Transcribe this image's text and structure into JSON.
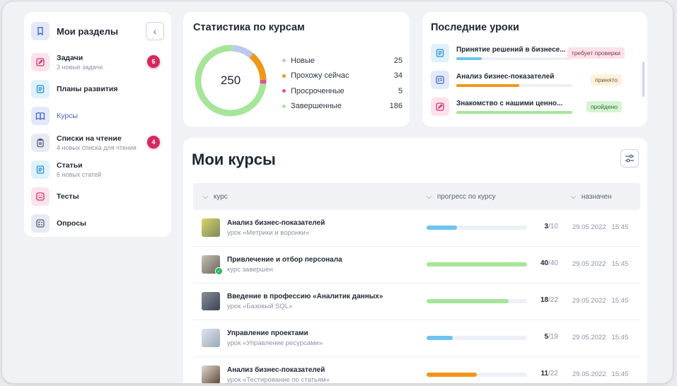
{
  "sidebar": {
    "title": "Мои разделы",
    "collapse_icon": "chevron-left-icon",
    "items": [
      {
        "label": "Задачи",
        "sub": "3 новые задачи",
        "badge": "6",
        "icon": "pencil-icon",
        "color": "pink"
      },
      {
        "label": "Планы развития",
        "sub": "",
        "badge": "",
        "icon": "document-icon",
        "color": "cyan"
      },
      {
        "label": "Курсы",
        "sub": "",
        "badge": "",
        "icon": "book-icon",
        "color": "blue",
        "active": true
      },
      {
        "label": "Списки на чтение",
        "sub": "4 новых списка для чтения",
        "badge": "4",
        "icon": "clipboard-icon",
        "color": "gray"
      },
      {
        "label": "Статьи",
        "sub": "6 новых статей",
        "badge": "",
        "icon": "document-icon",
        "color": "cyan"
      },
      {
        "label": "Тесты",
        "sub": "",
        "badge": "",
        "icon": "quiz-icon",
        "color": "pink"
      },
      {
        "label": "Опросы",
        "sub": "",
        "badge": "",
        "icon": "checklist-icon",
        "color": "gray"
      }
    ]
  },
  "stats": {
    "title": "Статистика по курсам",
    "total": "250",
    "items": [
      {
        "name": "Новые",
        "value": 25,
        "color": "#b7c9ef"
      },
      {
        "name": "Прохожу сейчас",
        "value": 34,
        "color": "#f0971b"
      },
      {
        "name": "Просроченные",
        "value": 5,
        "color": "#e0568f"
      },
      {
        "name": "Завершенные",
        "value": 186,
        "color": "#a6e59a"
      }
    ]
  },
  "recent": {
    "title": "Последние уроки",
    "items": [
      {
        "title": "Принятие решений в бизнесе...",
        "progress": 0.22,
        "bar_color": "#6fc3ee",
        "tag": "требует проверки",
        "tag_style": "pink",
        "icon": "document-icon"
      },
      {
        "title": "Анализ бизнес-показателей",
        "progress": 0.54,
        "bar_color": "#f0971b",
        "tag": "принято",
        "tag_style": "yellow",
        "icon": "list-icon"
      },
      {
        "title": "Знакомство с нашими ценно...",
        "progress": 1.0,
        "bar_color": "#a6e59a",
        "tag": "пройдено",
        "tag_style": "green",
        "icon": "pencil-icon"
      }
    ]
  },
  "courses": {
    "title": "Мои курсы",
    "filter_icon": "sliders-icon",
    "headers": {
      "course": "курс",
      "progress": "прогресс по курсу",
      "assigned": "назначен"
    },
    "rows": [
      {
        "title": "Анализ бизнес-показателей",
        "sub": "урок «Метрики и воронки»",
        "done": 3,
        "total": 10,
        "color": "#6fc3ee",
        "date": "29.05.2022",
        "time": "15:45",
        "completed": false
      },
      {
        "title": "Привлечение и отбор персонала",
        "sub": "курс завершен",
        "done": 40,
        "total": 40,
        "color": "#a6e59a",
        "date": "29.05.2022",
        "time": "15:45",
        "completed": true
      },
      {
        "title": "Введение в профессию «Аналитик данных»",
        "sub": "урок «Базовый SQL»",
        "done": 18,
        "total": 22,
        "color": "#a6e59a",
        "date": "29.05.2022",
        "time": "15:45",
        "completed": false
      },
      {
        "title": "Управление проектами",
        "sub": "урок «Управление ресурсами»",
        "done": 5,
        "total": 19,
        "color": "#6fc3ee",
        "date": "29.05.2022",
        "time": "15:45",
        "completed": false
      },
      {
        "title": "Анализ бизнес-показателей",
        "sub": "урок «Тестирование по статьям»",
        "done": 11,
        "total": 22,
        "color": "#f0971b",
        "date": "29.05.2022",
        "time": "15:45",
        "completed": false
      }
    ]
  }
}
